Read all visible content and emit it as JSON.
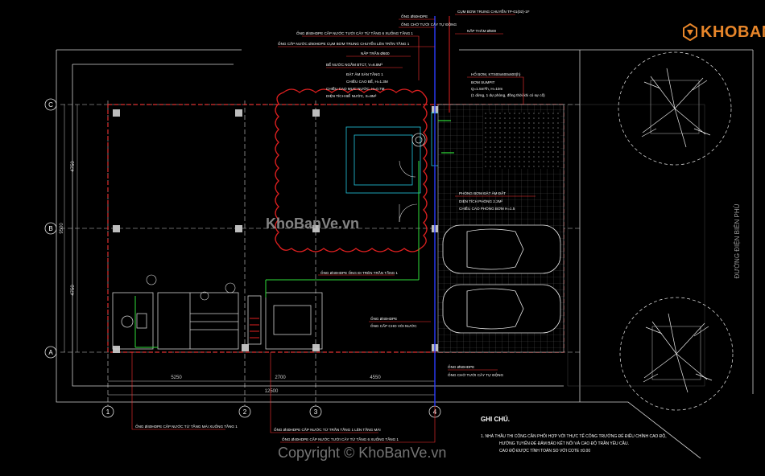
{
  "brand": {
    "logo_text": "KHOBANVE",
    "watermark": "KhoBanVe.vn",
    "copyright": "Copyright © KhoBanVe.vn"
  },
  "colors": {
    "background": "#000000",
    "grid": "#cfcfcf",
    "wall": "#e03030",
    "cloud": "#e02020",
    "pipe_blue": "#2a3cff",
    "pipe_red": "#e02020",
    "leader": "#ff3333",
    "green": "#2fdc3a",
    "cyan": "#22c8e0",
    "yellow": "#f0e040",
    "brand_orange": "#e8862a"
  },
  "grid": {
    "rows": [
      "C",
      "B",
      "A"
    ],
    "cols": [
      "1",
      "2",
      "3",
      "4"
    ],
    "row_dims": [
      "4750",
      "9500",
      "4750"
    ],
    "col_dims": [
      "5250",
      "2700",
      "4550"
    ],
    "total": "12500"
  },
  "street_label": "ĐƯỜNG ĐIỆN BIÊN PHỦ",
  "labels": {
    "top1": "ỐNG Ø50HDPE",
    "top2": "ỐNG CHỜ TƯỚI CÂY TỰ ĐỘNG",
    "top3": "ỐNG Ø40HDPE CẤP NƯỚC TƯỚI CÂY TỪ TẦNG 6 XUỐNG TẦNG 1",
    "top4": "ỐNG CẤP NƯỚC Ø40HDPE CỤM BƠM TRUNG CHUYỂN LÊN TRẦN TẦNG 1",
    "top5": "CỤM BƠM TRUNG CHUYỂN TP-01(02)-1F",
    "top6": "NẮP TRẦN Ø600",
    "top7": "NẮP THĂM Ø600",
    "top8": "BỂ NƯỚC NGẦM BTCT, V=6.8M³",
    "top9": "ĐẶT ÂM SÀN TẦNG 1",
    "top10": "CHIỀU CAO BỂ, H=1.3M",
    "top11": "CHIỀU CAO MỰC NƯỚC, H=0.7M",
    "top12": "DIỆN TÍCH BỂ NƯỚC, S=8M²",
    "pit1": "HỐ BƠM, KT:600x600x600(h)",
    "pit2": "BƠM SUMPIT",
    "pit3": "Q=1.5m³/h, H=10m",
    "pit4": "(1 dừng, 1 dự phòng, đồng thời khi có sự cố)",
    "room1": "PHÒNG BƠM ĐẶT ÂM ĐẤT",
    "room2": "DIỆN TÍCH PHÒNG 2.2M²",
    "room3": "CHIỀU CAO PHÒNG BƠM H=1.5",
    "mid1": "ỐNG Ø40HDPE ỐNG ĐI TRÊN TRẦN TẦNG 1",
    "mid2": "ỐNG Ø40HDPE",
    "mid3": "ỐNG CẤP CHO VÒI NƯỚC",
    "bot1": "ỐNG Ø50HDPE",
    "bot2": "ỐNG CHỜ TƯỚI CÂY TỰ ĐỘNG",
    "bot3": "ỐNG Ø40HDPE CẤP NƯỚC TỪ TẦNG MÁI XUỐNG TẦNG 1",
    "bot4": "ỐNG Ø40HDPE CẤP NƯỚC TỪ TRẦN TẦNG 1 LÊN TẦNG MÁI",
    "bot5": "ỐNG Ø40HDPE CẤP NƯỚC TƯỚI CÂY TỪ TẦNG 6 XUỐNG TẦNG 1"
  },
  "notes": {
    "title": "GHI CHÚ.",
    "n1": "1.      NHÀ THẦU THI CÔNG CẦN PHỐI HỢP VỚI THỰC TẾ CÔNG TRƯỜNG ĐỂ ĐIỀU CHỈNH CAO ĐỘ,",
    "n2": "HƯỚNG TUYẾN ĐỂ ĐẢM BẢO KẾT NỐI VÀ CAO ĐỘ TRẦN YÊU CẦU.",
    "n3": "CAO ĐỘ ĐƯỢC TÍNH TOÁN SO VỚI COTE ±0.00"
  }
}
